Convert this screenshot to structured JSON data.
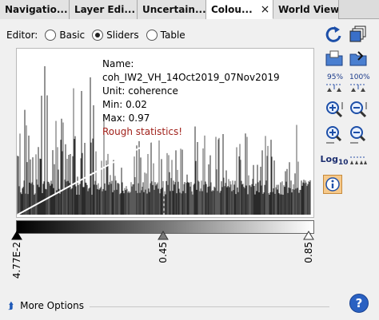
{
  "tabs": [
    {
      "label": "Navigatio..."
    },
    {
      "label": "Layer Edi..."
    },
    {
      "label": "Uncertain..."
    },
    {
      "label": "Colou...",
      "close": "×"
    },
    {
      "label": "World View"
    }
  ],
  "editor": {
    "label": "Editor:",
    "options": [
      {
        "label": "Basic",
        "checked": false
      },
      {
        "label": "Sliders",
        "checked": true
      },
      {
        "label": "Table",
        "checked": false
      }
    ]
  },
  "info": {
    "name": "Name: coh_IW2_VH_14Oct2019_07Nov2019",
    "unit": "Unit: coherence",
    "min": "Min: 0.02",
    "max": "Max: 0.97",
    "warning": "Rough statistics!"
  },
  "sliders": [
    {
      "label": "4.77E-2",
      "value": 0.0477
    },
    {
      "label": "0.45",
      "value": 0.45
    },
    {
      "label": "0.85",
      "value": 0.85
    }
  ],
  "zoom": {
    "pct95": "95%",
    "pct100": "100%"
  },
  "log_label": "Log",
  "log_sub": "10",
  "footer": {
    "more_options": "More Options",
    "help": "?"
  },
  "colors": {
    "accent": "#2a61c2",
    "warning": "#a0201a"
  }
}
